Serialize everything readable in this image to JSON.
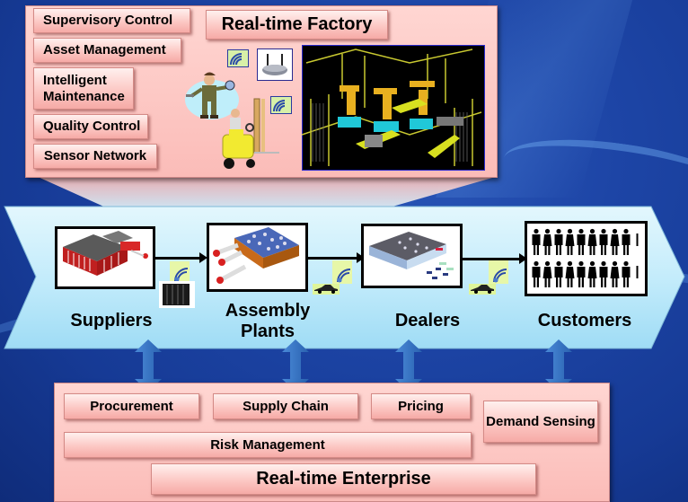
{
  "factory": {
    "title": "Real-time Factory",
    "functions": [
      {
        "label": "Supervisory Control"
      },
      {
        "label": "Asset Management"
      },
      {
        "label": "Intelligent Maintenance"
      },
      {
        "label": "Quality Control"
      },
      {
        "label": "Sensor Network"
      }
    ],
    "images": {
      "worker": "maintenance-worker-illustration",
      "forklift": "forklift-illustration",
      "router": "wireless-router-photo",
      "robot_cell": "robotic-assembly-cell-render"
    }
  },
  "value_chain": {
    "stages": [
      {
        "label": "Suppliers",
        "image": "supplier-factory-illustration"
      },
      {
        "label": "Assembly Plants",
        "image": "assembly-plant-illustration"
      },
      {
        "label": "Dealers",
        "image": "dealer-lot-illustration"
      },
      {
        "label": "Customers",
        "image": "customer-crowd-icons"
      }
    ],
    "transport_icons": [
      "container-with-wireless",
      "car-with-wireless",
      "car-with-wireless"
    ]
  },
  "enterprise": {
    "title": "Real-time Enterprise",
    "functions": [
      {
        "label": "Procurement"
      },
      {
        "label": "Supply Chain"
      },
      {
        "label": "Pricing"
      },
      {
        "label": "Demand Sensing"
      },
      {
        "label": "Risk Management"
      }
    ]
  },
  "colors": {
    "background": "#1d45a6",
    "panel_pink": "#fbbcb8",
    "chevron_light_blue": "#bfeafc",
    "arrow_blue": "#3a78c8"
  }
}
